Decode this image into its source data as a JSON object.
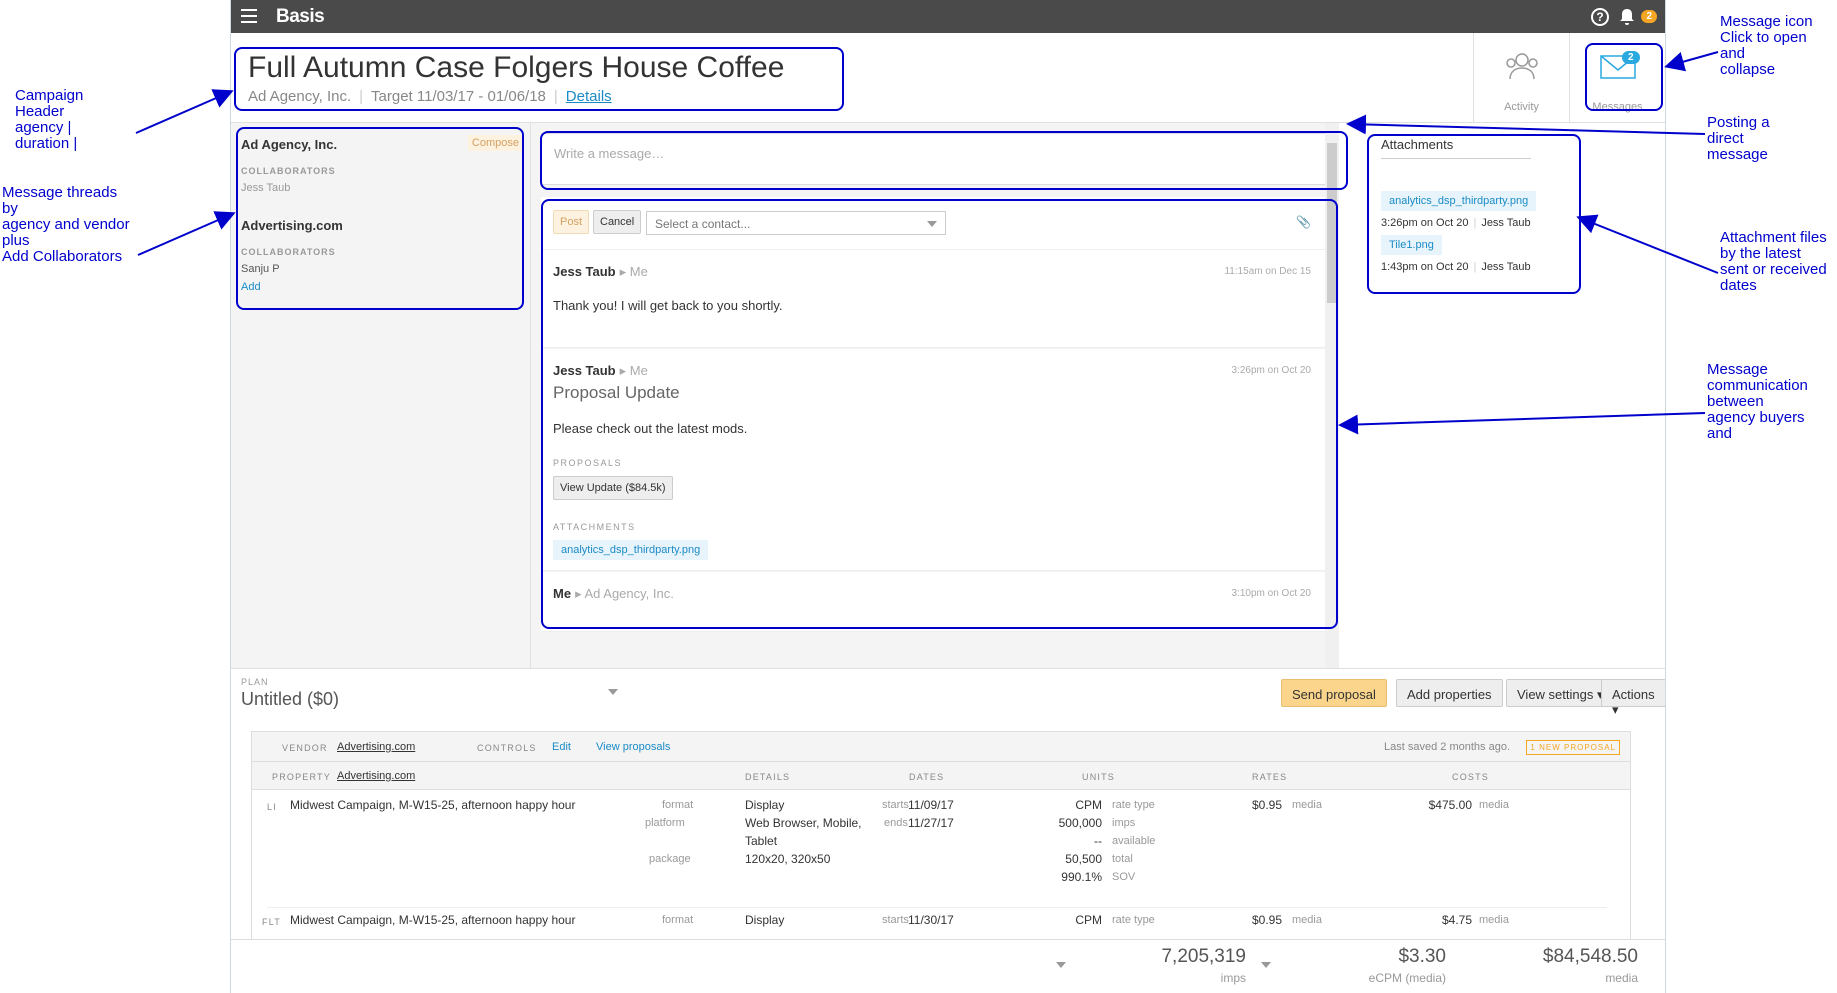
{
  "annotations": {
    "campaign_header": [
      "Campaign",
      "Header",
      "agency |",
      "duration |"
    ],
    "message_threads": [
      "Message threads",
      "by",
      "agency and vendor",
      "plus",
      "Add Collaborators"
    ],
    "message_icon": [
      "Message icon",
      "Click to open",
      "and",
      "collapse"
    ],
    "posting": [
      "Posting a",
      "direct",
      "message"
    ],
    "attachments": [
      "Attachment files",
      "by the latest",
      "sent or received",
      "dates"
    ],
    "communication": [
      "Message",
      "communication",
      "between",
      "agency buyers",
      "and"
    ]
  },
  "topbar": {
    "logo": "Basis",
    "help": "?",
    "notif_count": "2"
  },
  "header": {
    "title": "Full Autumn Case Folgers House Coffee",
    "agency": "Ad Agency, Inc.",
    "target": "Target 11/03/17 - 01/06/18",
    "details": "Details",
    "activity_label": "Activity",
    "messages_label": "Messages",
    "messages_badge": "2"
  },
  "threads": [
    {
      "name": "Ad Agency, Inc.",
      "compose": "Compose",
      "collab_label": "COLLABORATORS",
      "people": [
        "Jess Taub"
      ]
    },
    {
      "name": "Advertising.com",
      "collab_label": "COLLABORATORS",
      "people": [
        "Sanju P"
      ],
      "add": "Add"
    }
  ],
  "composer": {
    "placeholder": "Write a message…",
    "post": "Post",
    "cancel": "Cancel",
    "contact_placeholder": "Select a contact..."
  },
  "messages": [
    {
      "from": "Jess Taub",
      "to": "Me",
      "time": "11:15am on Dec 15",
      "body": "Thank you! I will get back to you shortly."
    },
    {
      "from": "Jess Taub",
      "to": "Me",
      "time": "3:26pm on Oct 20",
      "subject": "Proposal Update",
      "body": "Please check out the latest mods.",
      "proposals_label": "PROPOSALS",
      "proposal_button": "View Update ($84.5k)",
      "attachments_label": "ATTACHMENTS",
      "attachment": "analytics_dsp_thirdparty.png"
    },
    {
      "from": "Me",
      "to": "Ad Agency, Inc.",
      "time": "3:10pm on Oct 20"
    }
  ],
  "attachments": {
    "title": "Attachments",
    "items": [
      {
        "file": "analytics_dsp_thirdparty.png",
        "when": "3:26pm on Oct 20",
        "who": "Jess Taub"
      },
      {
        "file": "Tile1.png",
        "when": "1:43pm on Oct 20",
        "who": "Jess Taub"
      }
    ]
  },
  "plan": {
    "label": "PLAN",
    "name": "Untitled ($0)",
    "send_proposal": "Send proposal",
    "add_properties": "Add properties",
    "view_settings": "View settings",
    "actions": "Actions"
  },
  "grid": {
    "vendor_label": "VENDOR",
    "vendor": "Advertising.com",
    "controls_label": "CONTROLS",
    "edit": "Edit",
    "view_proposals": "View proposals",
    "last_saved": "Last saved 2 months ago.",
    "new_proposal": "1 NEW PROPOSAL",
    "property_label": "PROPERTY",
    "property": "Advertising.com",
    "columns": [
      "DETAILS",
      "DATES",
      "UNITS",
      "RATES",
      "COSTS"
    ],
    "rows": [
      {
        "type": "LI",
        "name": "Midwest Campaign, M-W15-25, afternoon happy hour",
        "format_k": "format",
        "format": "Display",
        "platform_k": "platform",
        "platform": "Web Browser, Mobile,",
        "platform2": "Tablet",
        "package_k": "package",
        "package": "120x20, 320x50",
        "starts_k": "starts",
        "starts": "11/09/17",
        "ends_k": "ends",
        "ends": "11/27/17",
        "u1": "CPM",
        "u1k": "rate type",
        "u2": "500,000",
        "u2k": "imps",
        "u3": "--",
        "u3k": "available",
        "u4": "50,500",
        "u4k": "total",
        "u5": "990.1%",
        "u5k": "SOV",
        "rate": "$0.95",
        "rate_k": "media",
        "cost": "$475.00",
        "cost_k": "media"
      },
      {
        "type": "FLT",
        "name": "Midwest Campaign, M-W15-25, afternoon happy hour",
        "format_k": "format",
        "format": "Display",
        "starts_k": "starts",
        "starts": "11/30/17",
        "u1": "CPM",
        "u1k": "rate type",
        "rate": "$0.95",
        "rate_k": "media",
        "cost": "$4.75",
        "cost_k": "media"
      }
    ]
  },
  "footer": {
    "imps": "7,205,319",
    "imps_label": "imps",
    "ecpm": "$3.30",
    "ecpm_label": "eCPM (media)",
    "media": "$84,548.50",
    "media_label": "media"
  }
}
